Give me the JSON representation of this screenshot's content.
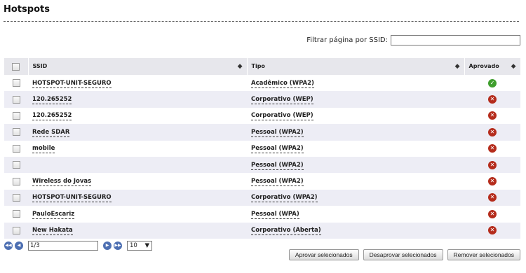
{
  "title": "Hotspots",
  "filter": {
    "label": "Filtrar página por SSID:",
    "value": ""
  },
  "columns": {
    "ssid": "SSID",
    "tipo": "Tipo",
    "aprovado": "Aprovado"
  },
  "sort_icon": "◆",
  "status_icons": {
    "approved": "✓",
    "rejected": "✕"
  },
  "rows": [
    {
      "ssid": "HOTSPOT-UNIT-SEGURO",
      "tipo": "Acadêmico (WPA2)",
      "approved": true
    },
    {
      "ssid": "120.265252",
      "tipo": "Corporativo (WEP)",
      "approved": false
    },
    {
      "ssid": "120.265252",
      "tipo": "Corporativo (WEP)",
      "approved": false
    },
    {
      "ssid": "Rede SDAR",
      "tipo": "Pessoal (WPA2)",
      "approved": false
    },
    {
      "ssid": "mobile",
      "tipo": "Pessoal (WPA2)",
      "approved": false
    },
    {
      "ssid": "",
      "tipo": "Pessoal (WPA2)",
      "approved": false
    },
    {
      "ssid": "Wireless do Jovas",
      "tipo": "Pessoal (WPA2)",
      "approved": false
    },
    {
      "ssid": "HOTSPOT-UNIT-SEGURO",
      "tipo": "Corporativo (WPA2)",
      "approved": false
    },
    {
      "ssid": "PauloEscariz",
      "tipo": "Pessoal (WPA)",
      "approved": false
    },
    {
      "ssid": "New Hakata",
      "tipo": "Corporativo (Aberta)",
      "approved": false
    }
  ],
  "pager": {
    "first": "◀◀",
    "prev": "◀",
    "next": "▶",
    "last": "▶▶",
    "page": "1/3",
    "page_size": "10",
    "dropdown_icon": "▼"
  },
  "buttons": {
    "approve": "Aprovar selecionados",
    "disapprove": "Desaprovar selecionados",
    "remove": "Remover selecionados"
  }
}
